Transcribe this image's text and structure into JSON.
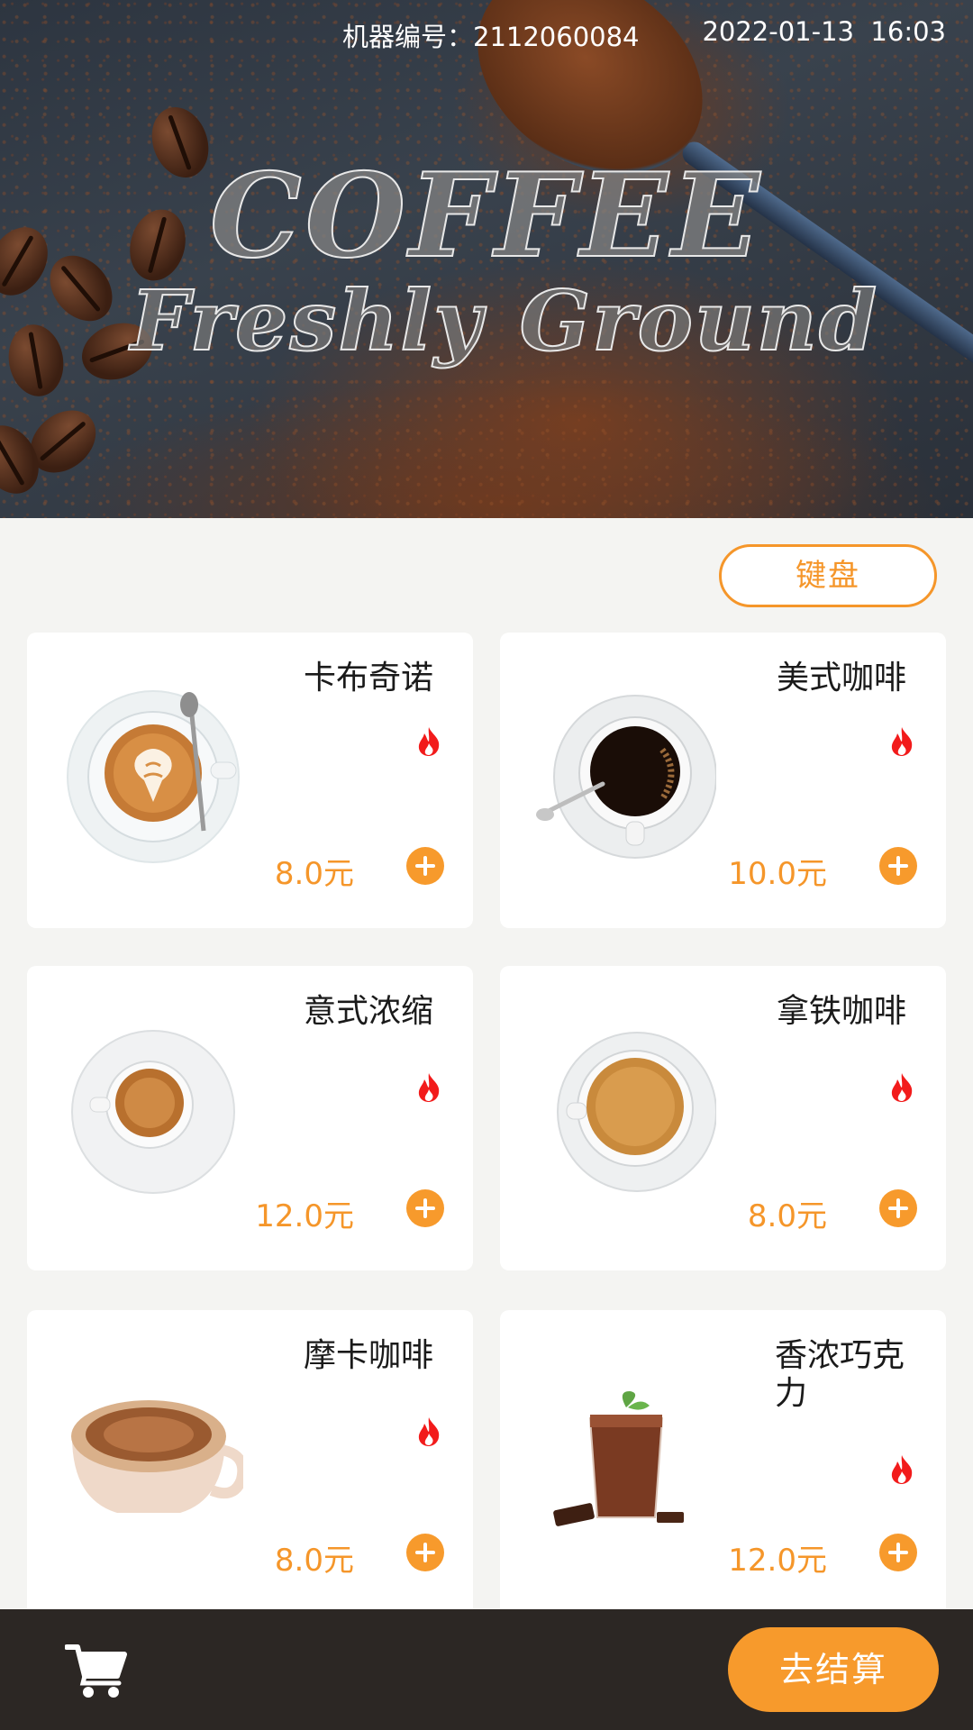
{
  "header": {
    "machine_id": "机器编号：2112060084",
    "datetime": "2022-01-13  16:03",
    "banner_title": "COFFEE",
    "banner_subtitle_1": "Freshly",
    "banner_subtitle_2": "Ground"
  },
  "keyboard_label": "键盘",
  "accent_color": "#f5962a",
  "products": [
    {
      "name": "卡布奇诺",
      "price": "8.0元",
      "hot": true,
      "icon": "cappuccino-cup"
    },
    {
      "name": "美式咖啡",
      "price": "10.0元",
      "hot": true,
      "icon": "americano-cup"
    },
    {
      "name": "意式浓缩",
      "price": "12.0元",
      "hot": true,
      "icon": "espresso-cup"
    },
    {
      "name": "拿铁咖啡",
      "price": "8.0元",
      "hot": true,
      "icon": "latte-cup"
    },
    {
      "name": "摩卡咖啡",
      "price": "8.0元",
      "hot": true,
      "icon": "mocha-cup"
    },
    {
      "name": "香浓巧克力",
      "price": "12.0元",
      "hot": true,
      "icon": "chocolate-glass"
    }
  ],
  "footer": {
    "checkout_label": "去结算",
    "cart_icon": "shopping-cart-icon"
  }
}
